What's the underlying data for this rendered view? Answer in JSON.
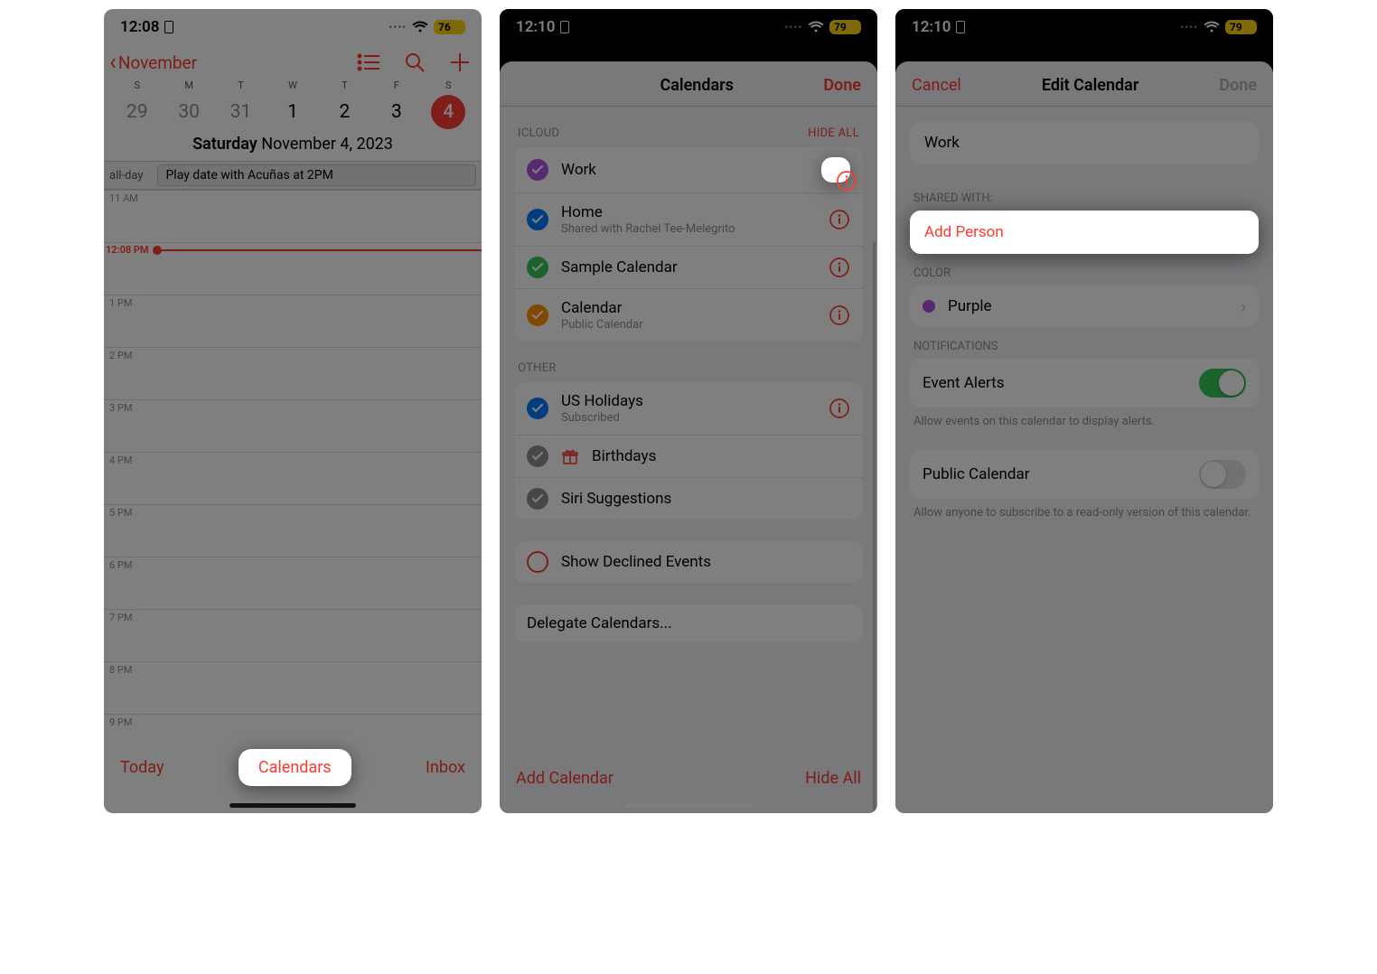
{
  "s1": {
    "status": {
      "time": "12:08",
      "battery": "76"
    },
    "nav": {
      "back": "November"
    },
    "week": [
      "S",
      "M",
      "T",
      "W",
      "T",
      "F",
      "S"
    ],
    "dates": [
      "29",
      "30",
      "31",
      "1",
      "2",
      "3",
      "4"
    ],
    "full_date_weekday": "Saturday",
    "full_date_rest": "  November 4, 2023",
    "allday_label": "all-day",
    "allday_event": "Play date with Acuñas at 2PM",
    "now_label": "12:08 PM",
    "hours": [
      "11 AM",
      "",
      "1 PM",
      "2 PM",
      "3 PM",
      "4 PM",
      "5 PM",
      "6 PM",
      "7 PM",
      "8 PM",
      "9 PM"
    ],
    "footer": {
      "today": "Today",
      "calendars": "Calendars",
      "inbox": "Inbox"
    }
  },
  "s2": {
    "status": {
      "time": "12:10",
      "battery": "79"
    },
    "title": "Calendars",
    "done": "Done",
    "sections": {
      "icloud": {
        "header": "ICLOUD",
        "hide": "HIDE ALL",
        "items": [
          {
            "title": "Work",
            "color": "purple"
          },
          {
            "title": "Home",
            "sub": "Shared with Rachel Tee-Melegrito",
            "color": "blue"
          },
          {
            "title": "Sample Calendar",
            "color": "green"
          },
          {
            "title": "Calendar",
            "sub": "Public Calendar",
            "color": "orange"
          }
        ]
      },
      "other": {
        "header": "OTHER",
        "items": [
          {
            "title": "US Holidays",
            "sub": "Subscribed",
            "color": "blue",
            "info": true
          },
          {
            "title": "Birthdays",
            "color": "gray",
            "gift": true
          },
          {
            "title": "Siri Suggestions",
            "color": "gray"
          }
        ]
      }
    },
    "declined": "Show Declined Events",
    "delegate": "Delegate Calendars...",
    "footer": {
      "add": "Add Calendar",
      "hide": "Hide All"
    }
  },
  "s3": {
    "status": {
      "time": "12:10",
      "battery": "79"
    },
    "cancel": "Cancel",
    "title": "Edit Calendar",
    "done": "Done",
    "name": "Work",
    "shared_with": "SHARED WITH:",
    "add_person": "Add Person",
    "color_hdr": "COLOR",
    "color_val": "Purple",
    "notif_hdr": "NOTIFICATIONS",
    "alerts": "Event Alerts",
    "alerts_help": "Allow events on this calendar to display alerts.",
    "public": "Public Calendar",
    "public_help": "Allow anyone to subscribe to a read-only version of this calendar."
  }
}
